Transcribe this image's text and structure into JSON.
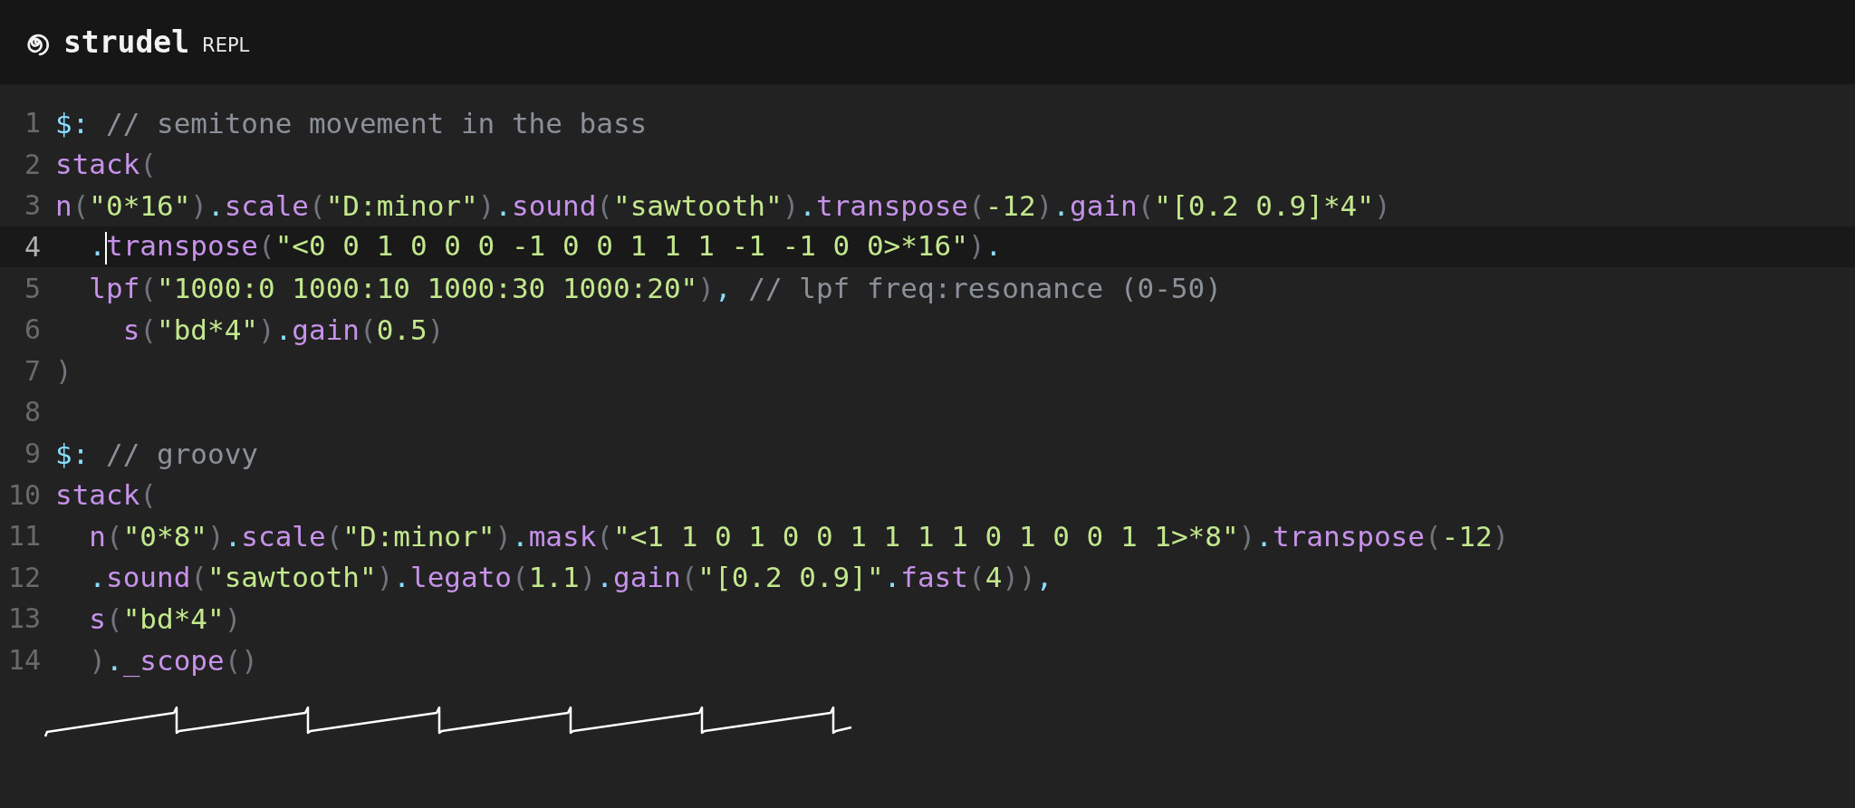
{
  "header": {
    "title": "strudel",
    "subtitle": "REPL"
  },
  "editor": {
    "lines": [
      {
        "number": "1",
        "active": false,
        "tokens": [
          {
            "kind": "keyword",
            "text": "$:"
          },
          {
            "kind": "comment",
            "text": " // semitone movement in the bass"
          }
        ]
      },
      {
        "number": "2",
        "active": false,
        "tokens": [
          {
            "kind": "func",
            "text": "stack"
          },
          {
            "kind": "paren",
            "text": "("
          }
        ]
      },
      {
        "number": "3",
        "active": false,
        "tokens": [
          {
            "kind": "func",
            "text": "n"
          },
          {
            "kind": "paren",
            "text": "("
          },
          {
            "kind": "string",
            "text": "\"0*16\""
          },
          {
            "kind": "paren",
            "text": ")"
          },
          {
            "kind": "dot",
            "text": "."
          },
          {
            "kind": "func",
            "text": "scale"
          },
          {
            "kind": "paren",
            "text": "("
          },
          {
            "kind": "string",
            "text": "\"D:minor\""
          },
          {
            "kind": "paren",
            "text": ")"
          },
          {
            "kind": "dot",
            "text": "."
          },
          {
            "kind": "func",
            "text": "sound"
          },
          {
            "kind": "paren",
            "text": "("
          },
          {
            "kind": "string",
            "text": "\"sawtooth\""
          },
          {
            "kind": "paren",
            "text": ")"
          },
          {
            "kind": "dot",
            "text": "."
          },
          {
            "kind": "func",
            "text": "transpose"
          },
          {
            "kind": "paren",
            "text": "("
          },
          {
            "kind": "number",
            "text": "-12"
          },
          {
            "kind": "paren",
            "text": ")"
          },
          {
            "kind": "dot",
            "text": "."
          },
          {
            "kind": "func",
            "text": "gain"
          },
          {
            "kind": "paren",
            "text": "("
          },
          {
            "kind": "string",
            "text": "\"[0.2 0.9]*4\""
          },
          {
            "kind": "paren",
            "text": ")"
          }
        ]
      },
      {
        "number": "4",
        "active": true,
        "tokens": [
          {
            "kind": "dot",
            "text": "  ."
          },
          {
            "kind": "cursor"
          },
          {
            "kind": "func",
            "text": "transpose"
          },
          {
            "kind": "paren",
            "text": "("
          },
          {
            "kind": "string",
            "text": "\"<0 0 1 0 0 0 -1 0 0 1 1 1 -1 -1 0 0>*16\""
          },
          {
            "kind": "paren",
            "text": ")"
          },
          {
            "kind": "dot",
            "text": "."
          }
        ]
      },
      {
        "number": "5",
        "active": false,
        "tokens": [
          {
            "kind": "func",
            "text": "  lpf"
          },
          {
            "kind": "paren",
            "text": "("
          },
          {
            "kind": "string",
            "text": "\"1000:0 1000:10 1000:30 1000:20\""
          },
          {
            "kind": "paren",
            "text": ")"
          },
          {
            "kind": "dot",
            "text": ","
          },
          {
            "kind": "comment",
            "text": " // lpf freq:resonance (0-50)"
          }
        ]
      },
      {
        "number": "6",
        "active": false,
        "tokens": [
          {
            "kind": "func",
            "text": "    s"
          },
          {
            "kind": "paren",
            "text": "("
          },
          {
            "kind": "string",
            "text": "\"bd*4\""
          },
          {
            "kind": "paren",
            "text": ")"
          },
          {
            "kind": "dot",
            "text": "."
          },
          {
            "kind": "func",
            "text": "gain"
          },
          {
            "kind": "paren",
            "text": "("
          },
          {
            "kind": "number",
            "text": "0.5"
          },
          {
            "kind": "paren",
            "text": ")"
          }
        ]
      },
      {
        "number": "7",
        "active": false,
        "tokens": [
          {
            "kind": "paren",
            "text": ")"
          }
        ]
      },
      {
        "number": "8",
        "active": false
      },
      {
        "number": "9",
        "active": false,
        "tokens": [
          {
            "kind": "keyword",
            "text": "$:"
          },
          {
            "kind": "comment",
            "text": " // groovy"
          }
        ]
      },
      {
        "number": "10",
        "active": false,
        "tokens": [
          {
            "kind": "func",
            "text": "stack"
          },
          {
            "kind": "paren",
            "text": "("
          }
        ]
      },
      {
        "number": "11",
        "active": false,
        "tokens": [
          {
            "kind": "func",
            "text": "  n"
          },
          {
            "kind": "paren",
            "text": "("
          },
          {
            "kind": "string",
            "text": "\"0*8\""
          },
          {
            "kind": "paren",
            "text": ")"
          },
          {
            "kind": "dot",
            "text": "."
          },
          {
            "kind": "func",
            "text": "scale"
          },
          {
            "kind": "paren",
            "text": "("
          },
          {
            "kind": "string",
            "text": "\"D:minor\""
          },
          {
            "kind": "paren",
            "text": ")"
          },
          {
            "kind": "dot",
            "text": "."
          },
          {
            "kind": "func",
            "text": "mask"
          },
          {
            "kind": "paren",
            "text": "("
          },
          {
            "kind": "string",
            "text": "\"<1 1 0 1 0 0 1 1 1 1 0 1 0 0 1 1>*8\""
          },
          {
            "kind": "paren",
            "text": ")"
          },
          {
            "kind": "dot",
            "text": "."
          },
          {
            "kind": "func",
            "text": "transpose"
          },
          {
            "kind": "paren",
            "text": "("
          },
          {
            "kind": "number",
            "text": "-12"
          },
          {
            "kind": "paren",
            "text": ")"
          }
        ]
      },
      {
        "number": "12",
        "active": false,
        "tokens": [
          {
            "kind": "dot",
            "text": "  ."
          },
          {
            "kind": "func",
            "text": "sound"
          },
          {
            "kind": "paren",
            "text": "("
          },
          {
            "kind": "string",
            "text": "\"sawtooth\""
          },
          {
            "kind": "paren",
            "text": ")"
          },
          {
            "kind": "dot",
            "text": "."
          },
          {
            "kind": "func",
            "text": "legato"
          },
          {
            "kind": "paren",
            "text": "("
          },
          {
            "kind": "number",
            "text": "1.1"
          },
          {
            "kind": "paren",
            "text": ")"
          },
          {
            "kind": "dot",
            "text": "."
          },
          {
            "kind": "func",
            "text": "gain"
          },
          {
            "kind": "paren",
            "text": "("
          },
          {
            "kind": "string",
            "text": "\"[0.2 0.9]\""
          },
          {
            "kind": "dot",
            "text": "."
          },
          {
            "kind": "func",
            "text": "fast"
          },
          {
            "kind": "paren",
            "text": "("
          },
          {
            "kind": "number",
            "text": "4"
          },
          {
            "kind": "paren",
            "text": "))"
          },
          {
            "kind": "dot",
            "text": ","
          }
        ]
      },
      {
        "number": "13",
        "active": false,
        "tokens": [
          {
            "kind": "func",
            "text": "  s"
          },
          {
            "kind": "paren",
            "text": "("
          },
          {
            "kind": "string",
            "text": "\"bd*4\""
          },
          {
            "kind": "paren",
            "text": ")"
          }
        ]
      },
      {
        "number": "14",
        "active": false,
        "tokens": [
          {
            "kind": "paren",
            "text": "  )"
          },
          {
            "kind": "dot",
            "text": "."
          },
          {
            "kind": "func",
            "text": "_scope"
          },
          {
            "kind": "paren",
            "text": "()"
          }
        ]
      }
    ]
  }
}
